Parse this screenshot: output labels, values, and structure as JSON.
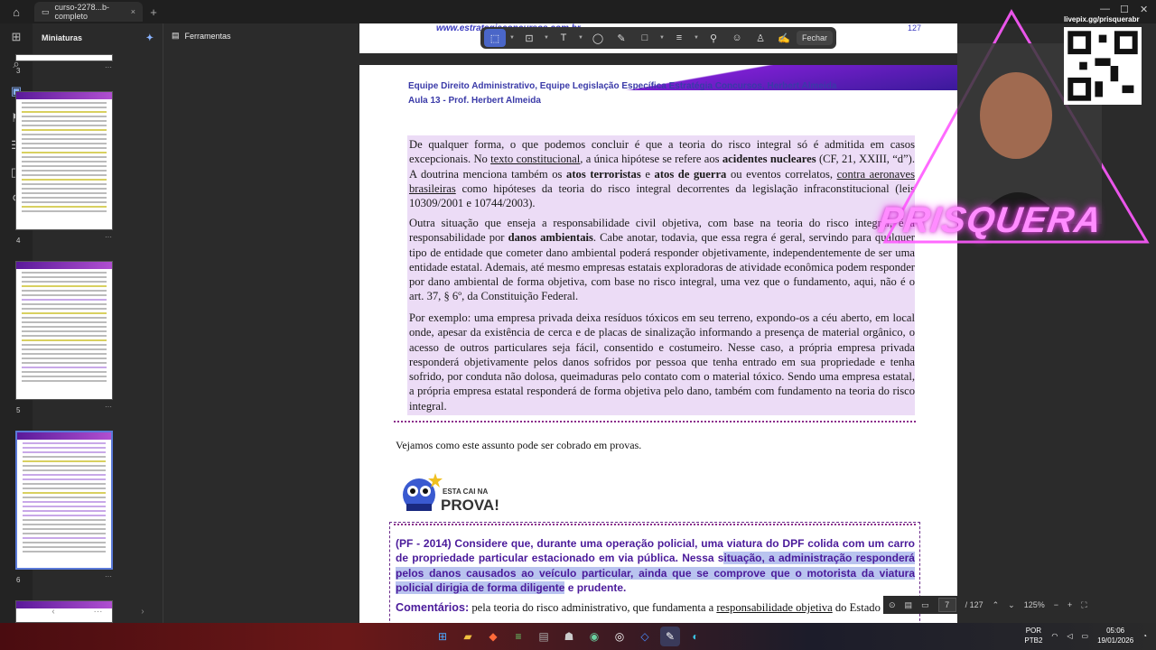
{
  "tabbar": {
    "tab_title": "curso-2278...b-completo",
    "close": "×",
    "add": "+"
  },
  "window": {
    "minimize": "—",
    "maximize": "☐",
    "close": "✕"
  },
  "thumb_panel": {
    "title": "Miniaturas",
    "pages": [
      {
        "num": "3"
      },
      {
        "num": "4"
      },
      {
        "num": "5"
      },
      {
        "num": "6"
      }
    ],
    "more": "···"
  },
  "tools": {
    "label": "Ferramentas"
  },
  "annotation_toolbar": {
    "close_label": "Fechar"
  },
  "document": {
    "url_fragment": "www.estrategiaconcursos.com.br",
    "page_number_top": "127",
    "header_line1": "Equipe Direito Administrativo, Equipe Legislação Específica Estratégia Concursos, Herbert Almeida",
    "header_line2": "Aula 13 - Prof. Herbert Almeida",
    "para1": {
      "t1": "De qualquer forma, o que podemos concluir é que a teoria do risco integral só é admitida em casos excepcionais. No ",
      "u1": "texto constitucional",
      "t2": ", a única hipótese se refere aos ",
      "b1": "acidentes nucleares",
      "t3": " (CF, 21, XXIII, “d”). A doutrina menciona também os ",
      "b2": "atos terroristas",
      "t4": " e ",
      "b3": "atos de guerra",
      "t5": " ou eventos correlatos, ",
      "u2": "contra aeronaves brasileiras",
      "t6": " como hipóteses da teoria do risco integral decorrentes da legislação infraconstitucional (leis 10309/2001 e 10744/2003)."
    },
    "para2": {
      "t1": "Outra situação que enseja a responsabilidade civil objetiva, com base na teoria do risco integral, é a responsabilidade por ",
      "b1": "danos ambientais",
      "t2": ". Cabe anotar, todavia, que essa regra é geral, servindo para qualquer tipo de entidade que cometer dano ambiental poderá responder objetivamente, independentemente de ser uma entidade estatal. Ademais, até mesmo empresas estatais exploradoras de atividade econômica podem responder por dano ambiental de forma objetiva, com base no risco integral, uma vez que o fundamento, aqui, não é o art. 37, § 6º, da Constituição Federal."
    },
    "para3": "Por exemplo: uma empresa privada deixa resíduos tóxicos em seu terreno, expondo-os a céu aberto, em local onde, apesar da existência de cerca e de placas de sinalização informando a presença de material orgânico, o acesso de outros particulares seja fácil, consentido e costumeiro. Nesse caso, a própria empresa privada responderá objetivamente pelos danos sofridos por pessoa que tenha entrado em sua propriedade e tenha sofrido, por conduta não dolosa, queimaduras pelo contato com o material tóxico. Sendo uma empresa estatal, a própria empresa estatal responderá de forma objetiva pelo dano, também com fundamento na teoria do risco integral.",
    "vejamos": "Vejamos como este assunto pode ser cobrado em provas.",
    "esta_cai": "ESTA CAI NA",
    "prova": "PROVA!",
    "question": {
      "t1": "(PF - 2014) Considere que, durante uma operação policial, uma viatura do DPF colida com um carro de propriedade particular estacionado em via pública. Nessa s",
      "hl": "ituação, a administração responderá pelos danos causados ao veículo particular, ainda que se comprove que o motorista da viatura policial dirigia de forma diligente",
      "t2": " e prudente."
    },
    "comentarios_label": "Comentários:",
    "comentarios_t1": " pela teoria do risco administrativo, que fundamenta a ",
    "comentarios_u": "responsabilidade objetiva",
    "comentarios_t2": " do Estado"
  },
  "status_bar": {
    "page_current": "7",
    "page_total": "/ 127",
    "zoom": "125%"
  },
  "stream_overlay": {
    "brand": "PRISQUERA",
    "qr_label": "livepix.gg/prisquerabr"
  },
  "tray": {
    "lang1": "POR",
    "lang2": "PTB2",
    "time": "05:06",
    "date": "19/01/2026"
  }
}
